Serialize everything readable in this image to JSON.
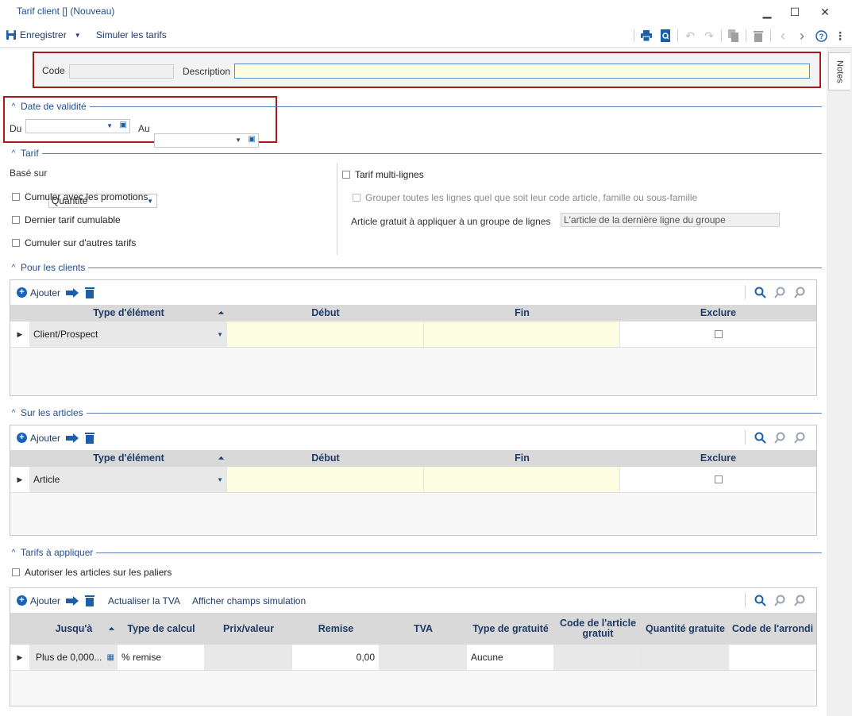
{
  "window": {
    "title": "Tarif client [] (Nouveau)",
    "minimize": "▁",
    "maximize": "☐",
    "close": "✕"
  },
  "toolbar": {
    "save_label": "Enregistrer",
    "simulate_label": "Simuler les tarifs"
  },
  "notes_tab": "Notes",
  "header": {
    "code_label": "Code",
    "code_value": "",
    "description_label": "Description",
    "description_value": ""
  },
  "validity": {
    "title": "Date de validité",
    "from_label": "Du",
    "from_value": "",
    "to_label": "Au",
    "to_value": ""
  },
  "tarif": {
    "title": "Tarif",
    "based_on_label": "Basé sur",
    "based_on_value": "Quantité",
    "cumulate_promotions": "Cumuler avec les promotions",
    "last_cumulative": "Dernier tarif cumulable",
    "cumulate_other": "Cumuler sur d'autres tarifs",
    "multi_lines": "Tarif multi-lignes",
    "group_lines": "Grouper toutes les lignes quel que soit leur code article, famille ou sous-famille",
    "free_article_label": "Article gratuit à appliquer à un groupe de lignes",
    "free_article_value": "L'article de la dernière ligne du groupe"
  },
  "clients": {
    "title": "Pour les clients",
    "add_label": "Ajouter",
    "columns": [
      "Type d'élément",
      "Début",
      "Fin",
      "Exclure"
    ],
    "rows": [
      {
        "type": "Client/Prospect",
        "start": "",
        "end": ""
      }
    ]
  },
  "articles": {
    "title": "Sur les articles",
    "add_label": "Ajouter",
    "columns": [
      "Type d'élément",
      "Début",
      "Fin",
      "Exclure"
    ],
    "rows": [
      {
        "type": "Article",
        "start": "",
        "end": ""
      }
    ]
  },
  "apply": {
    "title": "Tarifs à appliquer",
    "allow_tiers": "Autoriser les articles sur les paliers",
    "add_label": "Ajouter",
    "update_vat": "Actualiser la TVA",
    "show_simulation": "Afficher champs simulation",
    "columns": [
      "Jusqu'à",
      "Type de calcul",
      "Prix/valeur",
      "Remise",
      "TVA",
      "Type de gratuité",
      "Code de l'article gratuit",
      "Quantité gratuite",
      "Code de l'arrondi"
    ],
    "rows": [
      {
        "upto": "Plus de 0,000...",
        "calc_type": "% remise",
        "price": "",
        "discount": "0,00",
        "vat": "",
        "free_type": "Aucune",
        "free_code": "",
        "free_qty": "",
        "rounding": ""
      }
    ]
  }
}
